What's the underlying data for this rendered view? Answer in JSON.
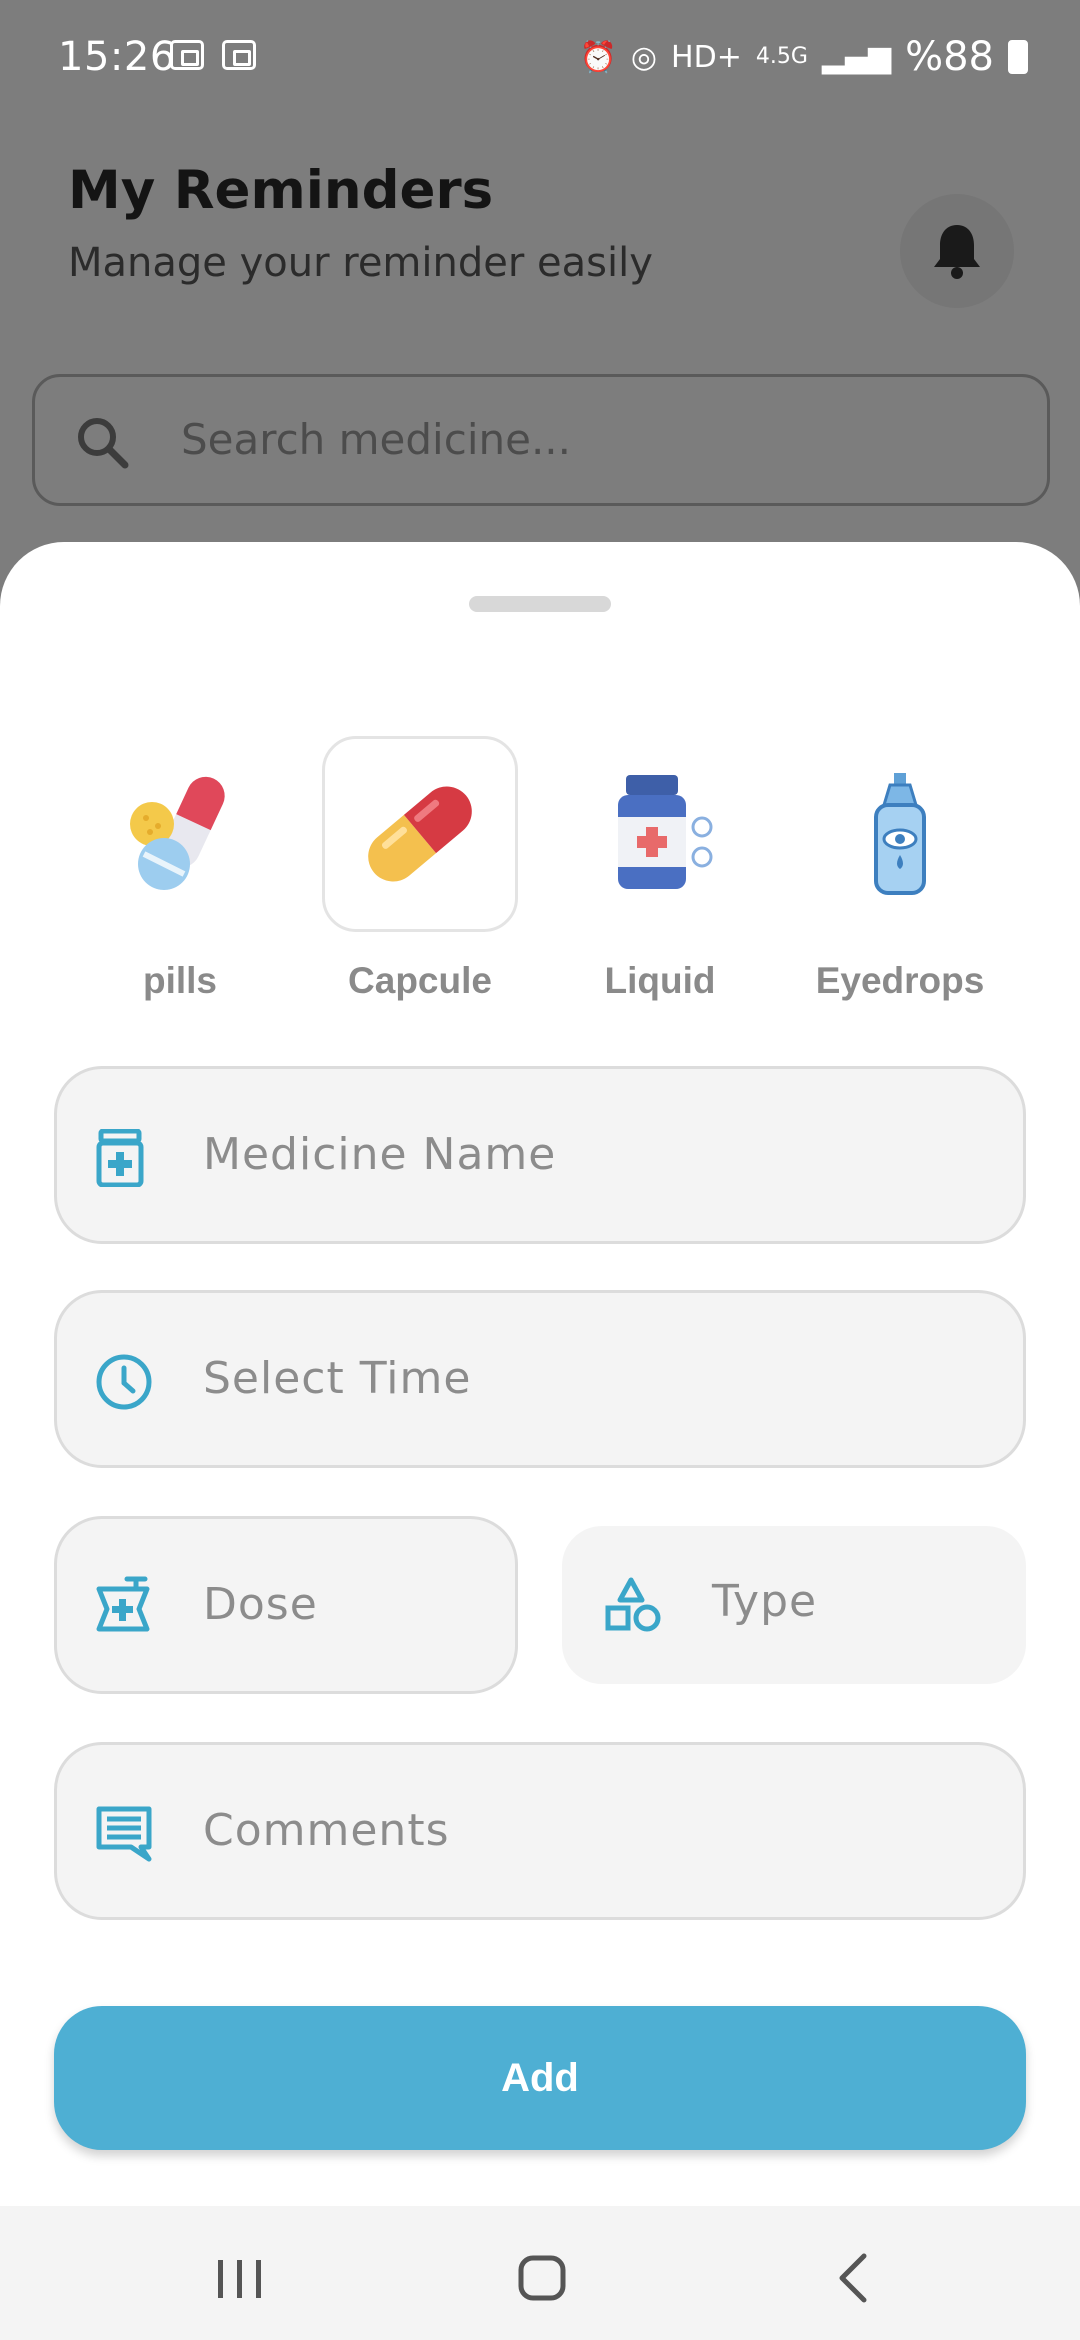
{
  "status_bar": {
    "time": "15:26",
    "network_label": "HD+",
    "network_type": "4.5G",
    "battery_text": "%88"
  },
  "header": {
    "title": "My Reminders",
    "subtitle": "Manage your reminder easily"
  },
  "search": {
    "placeholder": "Search medicine..."
  },
  "sheet": {
    "medicine_types": [
      {
        "label": "pills",
        "icon": "pills-icon",
        "selected": false
      },
      {
        "label": "Capcule",
        "icon": "capsule-icon",
        "selected": true
      },
      {
        "label": "Liquid",
        "icon": "liquid-bottle-icon",
        "selected": false
      },
      {
        "label": "Eyedrops",
        "icon": "eyedrops-icon",
        "selected": false
      }
    ],
    "fields": {
      "medicine_name": "Medicine Name",
      "select_time": "Select Time",
      "dose": "Dose",
      "type": "Type",
      "comments": "Comments"
    },
    "add_label": "Add"
  },
  "colors": {
    "accent": "#4eafd3",
    "icon_teal": "#3aa6c9",
    "scrim": "#7d7d7d"
  }
}
